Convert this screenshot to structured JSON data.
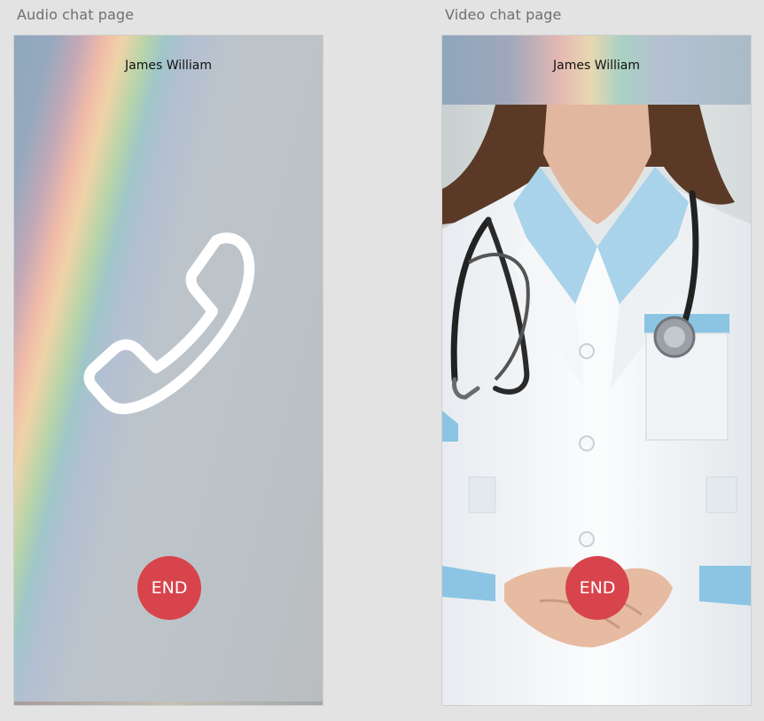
{
  "audio_page": {
    "label": "Audio chat page",
    "caller_name": "James William",
    "icon": "phone-icon",
    "end_label": "END"
  },
  "video_page": {
    "label": "Video chat page",
    "caller_name": "James William",
    "end_label": "END"
  },
  "colors": {
    "end_button": "#d8444c",
    "canvas": "#e3e3e3"
  }
}
